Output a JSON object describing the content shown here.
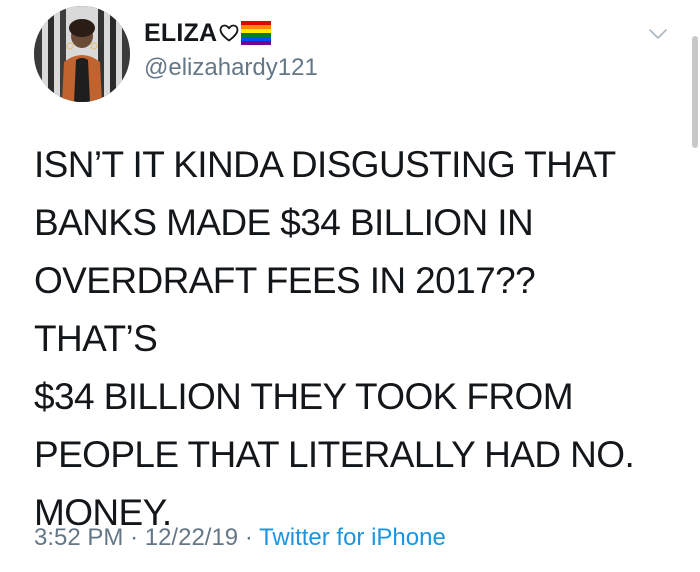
{
  "tweet": {
    "author": {
      "display_name": "ELIZA",
      "handle": "@elizahardy121",
      "name_icons": [
        "heart-outline-icon",
        "rainbow-flag-icon"
      ]
    },
    "text": "ISN’T IT KINDA DISGUSTING THAT\nBANKS MADE $34 BILLION IN\nOVERDRAFT FEES IN 2017?? THAT’S\n$34 BILLION THEY TOOK FROM\nPEOPLE THAT LITERALLY HAD NO.\nMONEY.",
    "time": "3:52 PM",
    "date": "12/22/19",
    "separator": "·",
    "source": "Twitter for iPhone",
    "menu_icon": "chevron-down-icon"
  },
  "colors": {
    "text": "#14171a",
    "secondary": "#657786",
    "link": "#1b95e0"
  }
}
